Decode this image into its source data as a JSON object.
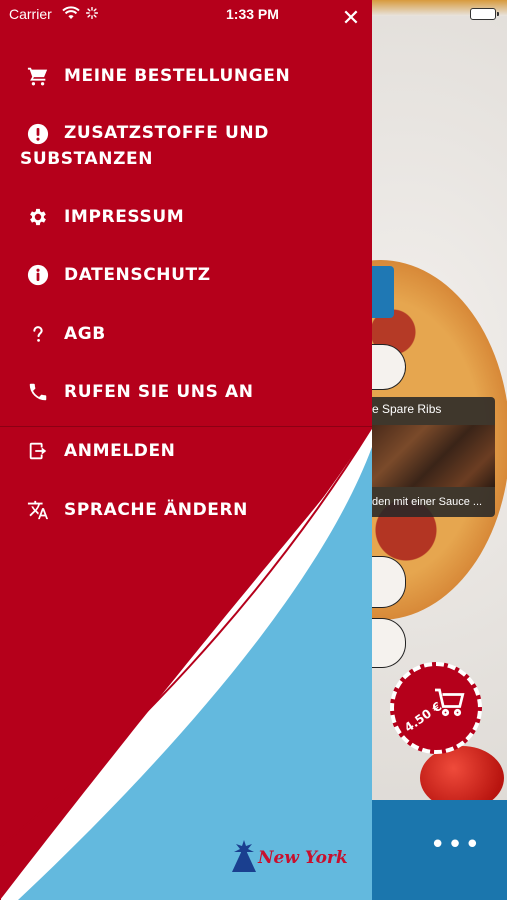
{
  "status_bar": {
    "carrier": "Carrier",
    "time": "1:33 PM"
  },
  "drawer": {
    "close_label": "✕",
    "menu": [
      {
        "label": "MEINE BESTELLUNGEN",
        "icon": "cart-icon"
      },
      {
        "label": "ZUSATZSTOFFE UND SUBSTANZEN",
        "icon": "alert-icon"
      },
      {
        "label": "IMPRESSUM",
        "icon": "gear-icon"
      },
      {
        "label": "DATENSCHUTZ",
        "icon": "info-icon"
      },
      {
        "label": "AGB",
        "icon": "question-icon"
      },
      {
        "label": "RUFEN SIE UNS AN",
        "icon": "phone-icon"
      },
      {
        "label": "ANMELDEN",
        "icon": "login-icon"
      },
      {
        "label": "SPRACHE ÄNDERN",
        "icon": "translate-icon"
      }
    ],
    "logo_text": "New York"
  },
  "background": {
    "product_title": "e Spare Ribs",
    "product_desc": "den mit einer Sauce ...",
    "cart_price": "4.50 €",
    "more_label": "•••"
  },
  "colors": {
    "drawer_red": "#b5001b",
    "art_blue": "#63b9de",
    "bar_blue": "#1b76ad"
  }
}
